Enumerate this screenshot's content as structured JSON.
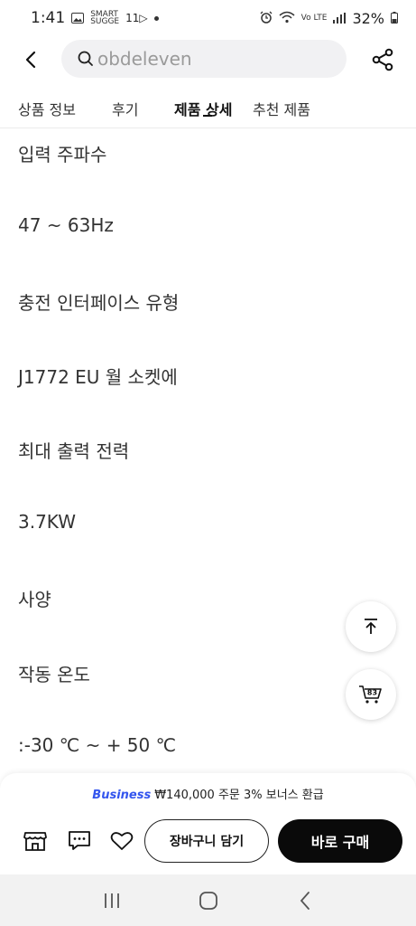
{
  "status_bar": {
    "time": "1:41",
    "notif_text_1": "SMART",
    "notif_text_2": "SUGGE",
    "notif_text_3": "11▷",
    "signal_text": "Vo LTE",
    "battery": "32%"
  },
  "header": {
    "search_placeholder": "obdeleven"
  },
  "tabs": [
    {
      "label": "상품 정보"
    },
    {
      "label": "후기"
    },
    {
      "label": "제품 상세"
    },
    {
      "label": "추천 제품"
    }
  ],
  "content": {
    "lines": [
      "입력 주파수",
      "47 ~ 63Hz",
      "충전 인터페이스 유형",
      "J1772 EU 월 소켓에",
      "최대 출력 전력",
      "3.7KW",
      "사양",
      "작동 온도",
      ":-30 ℃ ~ + 50 ℃"
    ]
  },
  "floating": {
    "cart_count": "83"
  },
  "bottom_bar": {
    "promo_brand": "Business",
    "promo_text": "₩140,000 주문 3% 보너스 환급",
    "add_to_cart": "장바구니 담기",
    "buy_now": "바로 구매"
  },
  "icons": {
    "back": "chevron-left-icon",
    "search": "search-icon",
    "share": "share-icon",
    "scroll_top": "arrow-up-icon",
    "cart": "cart-icon",
    "store": "store-icon",
    "chat": "chat-icon",
    "wishlist": "heart-icon"
  },
  "colors": {
    "accent_black": "#0a0a0a",
    "business_blue": "#3355ee",
    "search_bg": "#f1f1f3"
  }
}
